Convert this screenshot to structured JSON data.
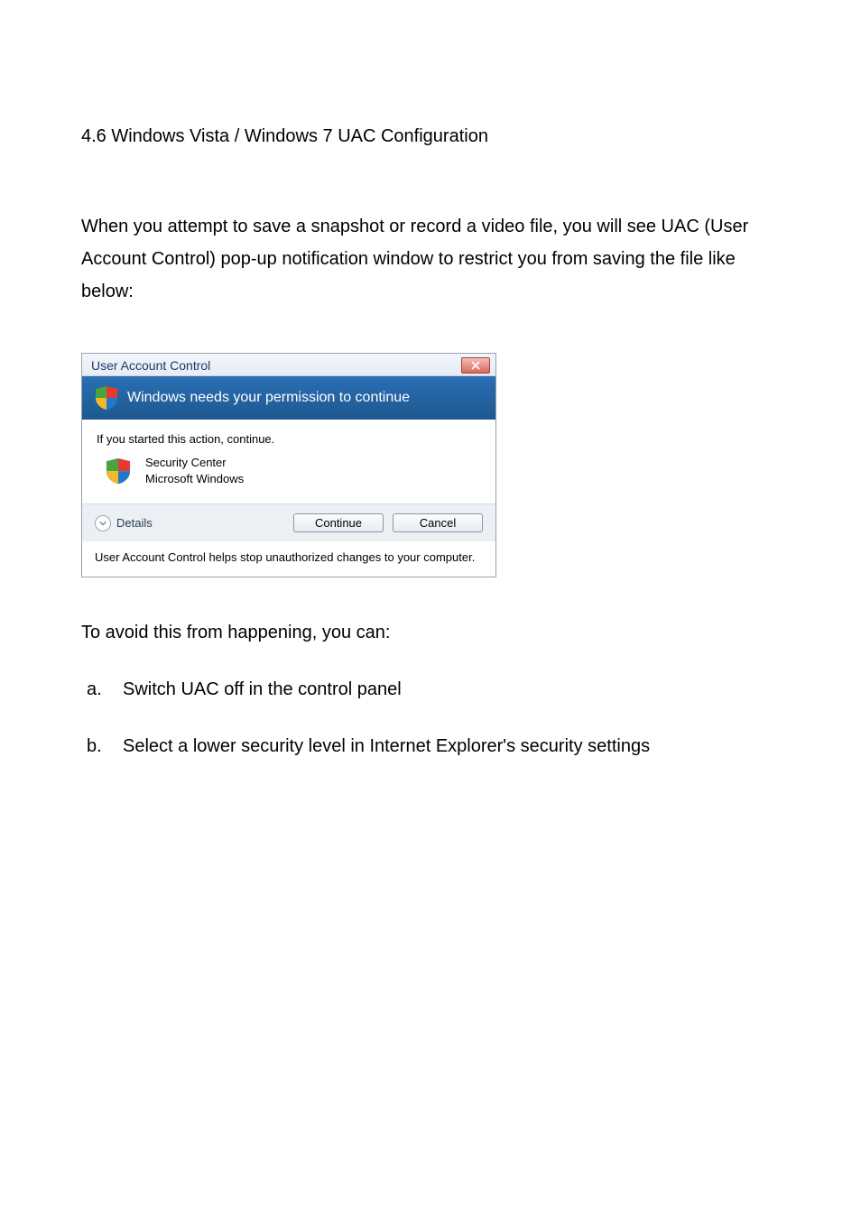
{
  "heading": "4.6 Windows Vista / Windows 7 UAC Configuration",
  "paragraph": "When you attempt to save a snapshot or record a video file, you will see UAC (User Account Control) pop-up notification window to restrict you from saving the file like below:",
  "dialog": {
    "title": "User Account Control",
    "banner": "Windows needs your permission to continue",
    "started": "If you started this action, continue.",
    "app_name": "Security Center",
    "app_publisher": "Microsoft Windows",
    "details_label": "Details",
    "continue_label": "Continue",
    "cancel_label": "Cancel",
    "footer": "User Account Control helps stop unauthorized changes to your computer."
  },
  "after_text": "To avoid this from happening, you can:",
  "list": [
    {
      "marker": "a.",
      "text": "Switch UAC off in the control panel"
    },
    {
      "marker": "b.",
      "text": "Select a lower security level in Internet Explorer's security settings"
    }
  ]
}
